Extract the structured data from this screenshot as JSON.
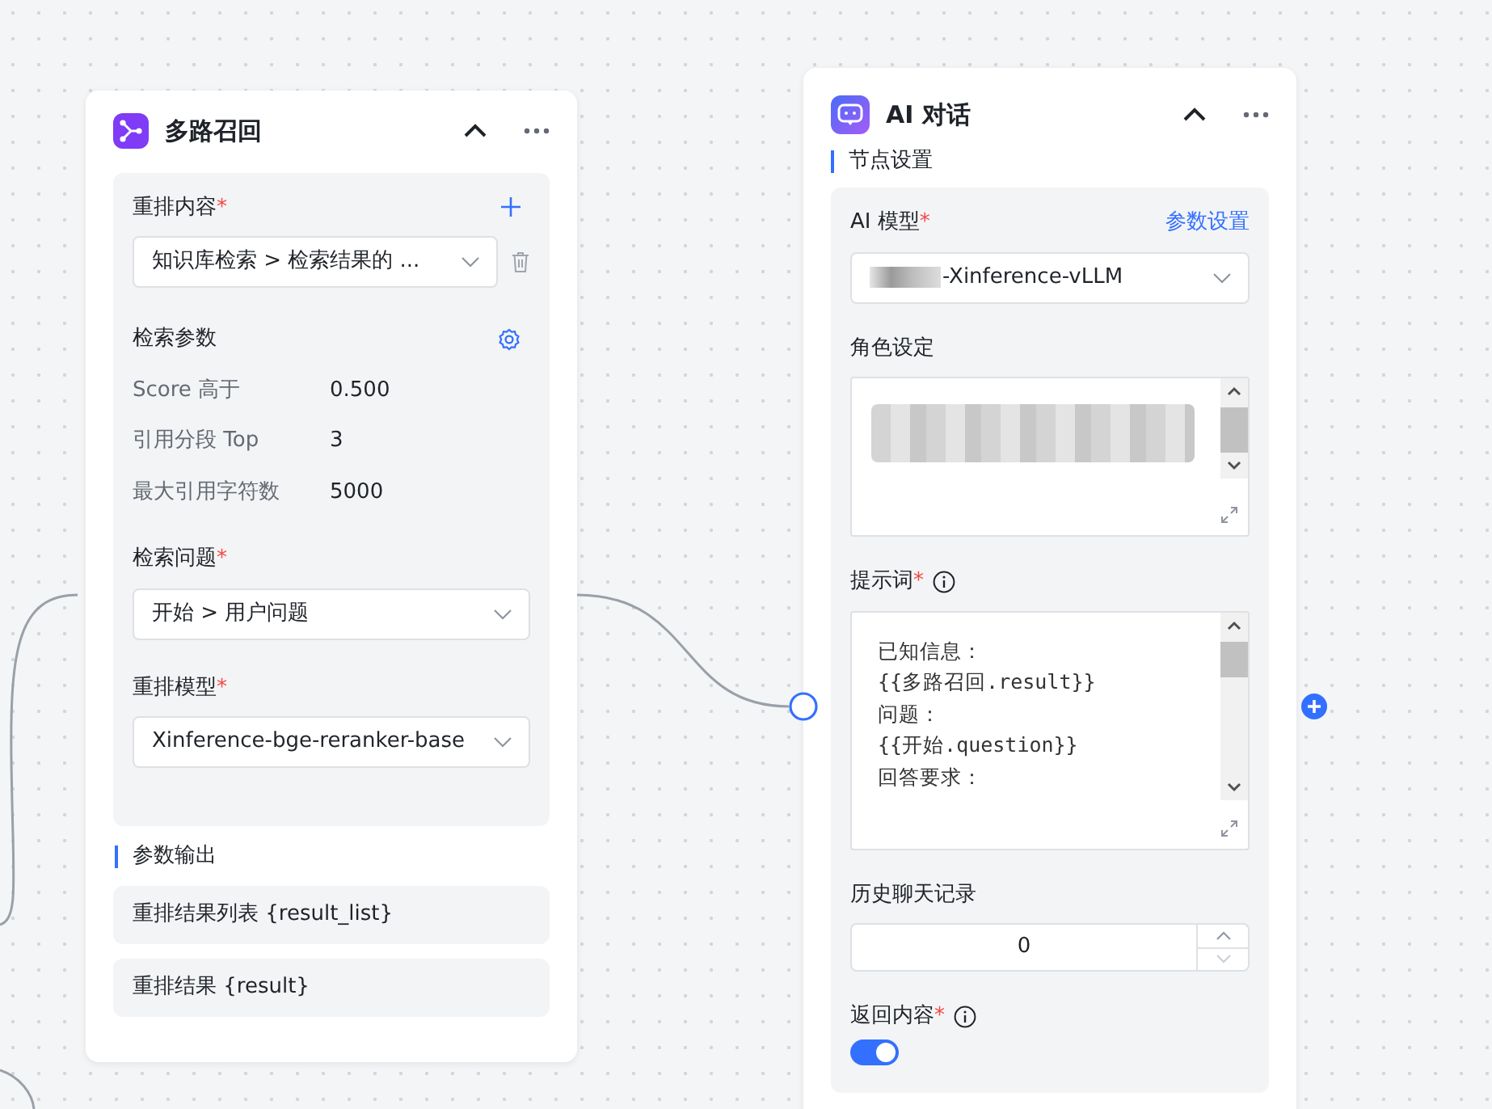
{
  "recall_node": {
    "title": "多路召回",
    "collapsed": false,
    "rerank_content": {
      "label": "重排内容",
      "required_mark": "*",
      "value": "知识库检索 > 检索结果的  ..."
    },
    "search_params": {
      "label": "检索参数",
      "rows": [
        {
          "label": "Score 高于",
          "value": "0.500"
        },
        {
          "label": "引用分段 Top",
          "value": "3"
        },
        {
          "label": "最大引用字符数",
          "value": "5000"
        }
      ]
    },
    "question": {
      "label": "检索问题",
      "required_mark": "*",
      "value": "开始 > 用户问题"
    },
    "rerank_model": {
      "label": "重排模型",
      "required_mark": "*",
      "value": "Xinference-bge-reranker-base"
    },
    "output": {
      "label": "参数输出",
      "items": [
        "重排结果列表 {result_list}",
        "重排结果 {result}"
      ]
    }
  },
  "chat_node": {
    "title": "AI 对话",
    "collapsed": false,
    "section": "节点设置",
    "model": {
      "label": "AI 模型",
      "required_mark": "*",
      "link": "参数设置",
      "value": "-Xinference-vLLM"
    },
    "role": {
      "label": "角色设定"
    },
    "prompt": {
      "label": "提示词",
      "required_mark": "*",
      "value": "已知信息：\n{{多路召回.result}}\n问题：\n{{开始.question}}\n回答要求："
    },
    "history": {
      "label": "历史聊天记录",
      "value": "0"
    },
    "return_content": {
      "label": "返回内容",
      "required_mark": "*",
      "on": true
    }
  }
}
